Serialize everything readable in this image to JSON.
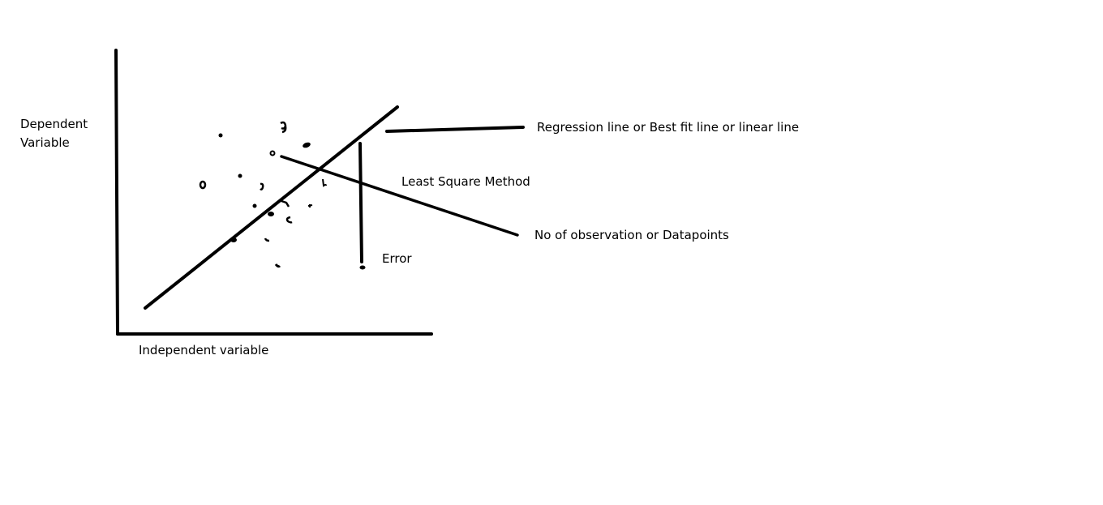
{
  "labels": {
    "y_axis_line1": "Dependent",
    "y_axis_line2": "Variable",
    "x_axis": "Independent variable",
    "regression": "Regression line or Best fit line or linear line",
    "method": "Least Square Method",
    "observations": "No of observation or Datapoints",
    "error": "Error"
  },
  "colors": {
    "ink": "#000000",
    "background": "#ffffff"
  }
}
